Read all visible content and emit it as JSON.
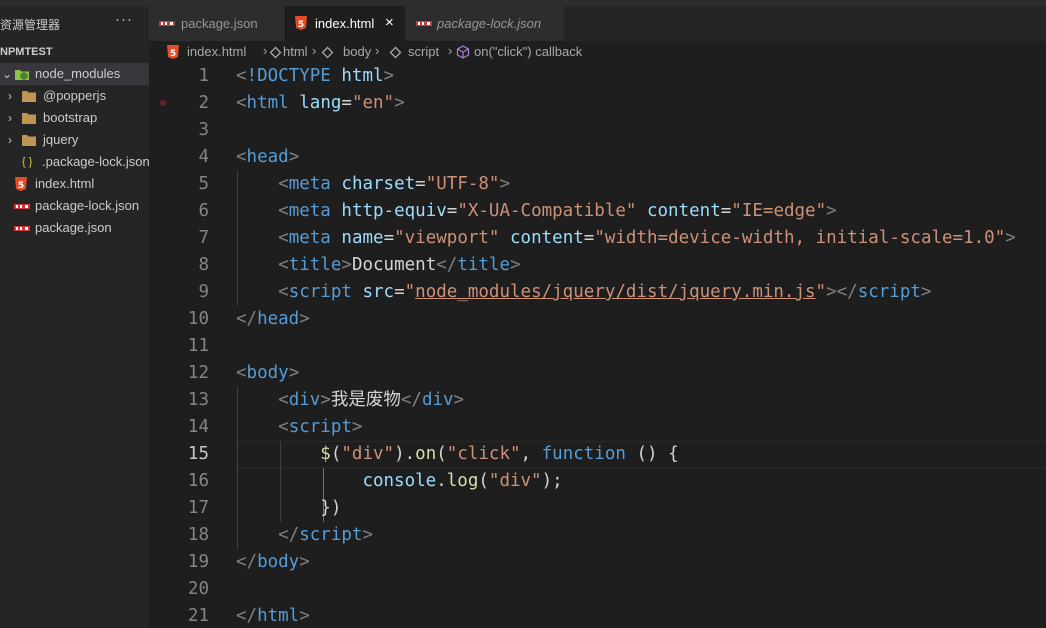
{
  "sidebar": {
    "title": "资源管理器",
    "more": "···",
    "section": "NPMTEST",
    "items": [
      {
        "label": "node_modules",
        "chevron": "⌄"
      },
      {
        "label": "@popperjs",
        "chevron": "›"
      },
      {
        "label": "bootstrap",
        "chevron": "›"
      },
      {
        "label": "jquery",
        "chevron": "›"
      },
      {
        "label": ".package-lock.json",
        "icon_text": "{ }"
      },
      {
        "label": "index.html",
        "icon_text": "5"
      },
      {
        "label": "package-lock.json"
      },
      {
        "label": "package.json"
      }
    ]
  },
  "tabs": [
    {
      "label": "package.json"
    },
    {
      "label": "index.html",
      "close": "×"
    },
    {
      "label": "package-lock.json"
    }
  ],
  "breadcrumbs": [
    "index.html",
    "html",
    "body",
    "script",
    "on(\"click\") callback"
  ],
  "breadcrumb_sep": "›",
  "editor": {
    "line_numbers": [
      "1",
      "2",
      "3",
      "4",
      "5",
      "6",
      "7",
      "8",
      "9",
      "10",
      "11",
      "12",
      "13",
      "14",
      "15",
      "16",
      "17",
      "18",
      "19",
      "20",
      "21"
    ],
    "current_line": "15"
  },
  "colors": {
    "tag": "#569cd6",
    "attribute": "#9cdcfe",
    "string": "#ce9178",
    "punctuation": "#808080",
    "function": "#dcdcaa",
    "html_icon": "#e44d26",
    "json_icon": "#cbcb41"
  }
}
